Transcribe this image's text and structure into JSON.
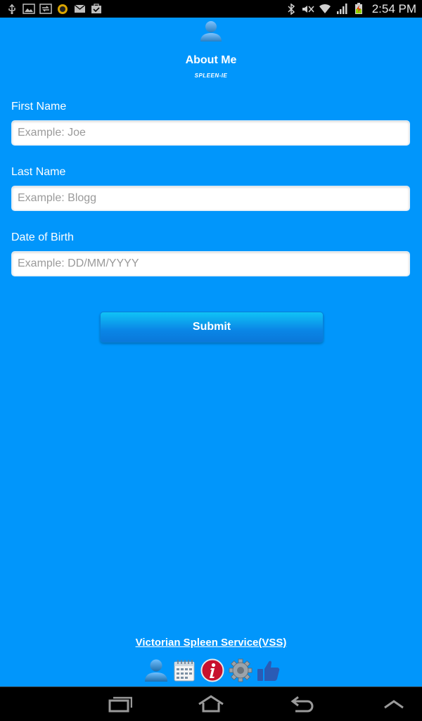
{
  "status_bar": {
    "time": "2:54 PM",
    "icons_left": [
      "usb-icon",
      "gallery-icon",
      "sync-icon",
      "bug-icon",
      "mail-icon",
      "briefcase-icon"
    ],
    "icons_right": [
      "bluetooth-icon",
      "mute-icon",
      "wifi-icon",
      "signal-icon",
      "battery-icon"
    ]
  },
  "header": {
    "title": "About Me",
    "subtitle": "SPLEEN-IE"
  },
  "form": {
    "first_name_label": "First Name",
    "first_name_placeholder": "Example: Joe",
    "last_name_label": "Last Name",
    "last_name_placeholder": "Example: Blogg",
    "dob_label": "Date of Birth",
    "dob_placeholder": "Example: DD/MM/YYYY",
    "submit_label": "Submit"
  },
  "footer": {
    "link_text": "Victorian Spleen Service(VSS)",
    "icons": [
      "person-icon",
      "calendar-icon",
      "info-icon",
      "settings-icon",
      "thumbs-up-icon"
    ]
  },
  "navbar": {
    "buttons": [
      "recent-apps-icon",
      "home-icon",
      "back-icon",
      "menu-up-icon"
    ]
  },
  "colors": {
    "background": "#0196fb",
    "button_top": "#10c3f6",
    "button_bottom": "#0a78da"
  }
}
